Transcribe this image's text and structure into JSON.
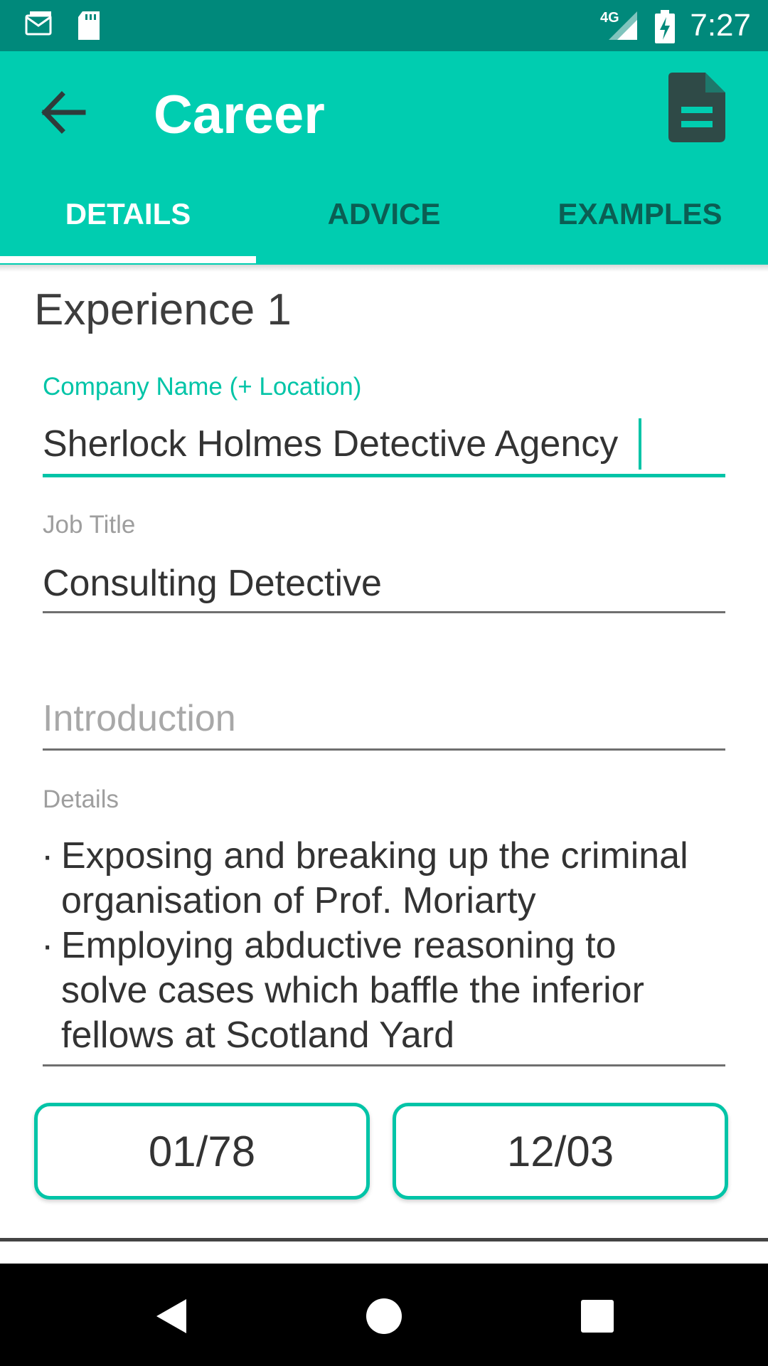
{
  "status_bar": {
    "network": "4G",
    "time": "7:27",
    "icons": [
      "mail-icon",
      "sd-card-icon",
      "signal-icon",
      "battery-charging-icon"
    ]
  },
  "toolbar": {
    "title": "Career",
    "back_icon": "arrow-left-icon",
    "action_icon": "document-icon"
  },
  "tabs": [
    {
      "label": "DETAILS",
      "active": true
    },
    {
      "label": "ADVICE",
      "active": false
    },
    {
      "label": "EXAMPLES",
      "active": false
    }
  ],
  "form": {
    "section_title": "Experience 1",
    "company": {
      "label": "Company Name (+ Location)",
      "value": "Sherlock Holmes Detective Agency"
    },
    "job_title": {
      "label": "Job Title",
      "value": "Consulting Detective"
    },
    "introduction": {
      "placeholder": "Introduction"
    },
    "details": {
      "label": "Details",
      "bullets": [
        [
          "Exposing and breaking up the criminal",
          "organisation of Prof. Moriarty"
        ],
        [
          "Employing abductive reasoning to",
          "solve cases which baffle the inferior",
          "fellows at Scotland Yard"
        ]
      ]
    },
    "start_date": "01/78",
    "end_date": "12/03"
  },
  "colors": {
    "accent": "#00cdb0",
    "status_bar": "#00897b",
    "focused": "#00c4a7"
  }
}
